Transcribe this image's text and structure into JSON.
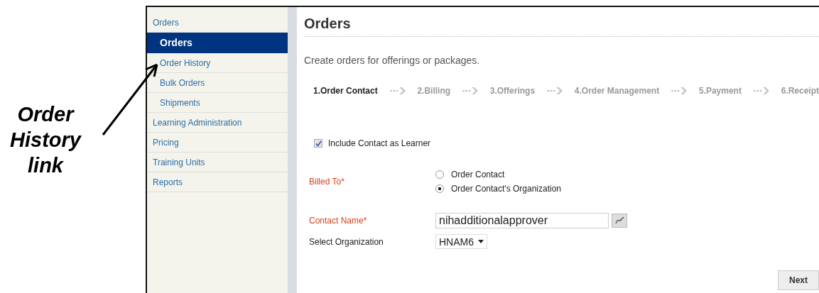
{
  "annotation": {
    "text": "Order History link"
  },
  "sidebar": {
    "items": [
      {
        "label": "Orders",
        "selected": false,
        "children": [
          {
            "label": "Orders",
            "selected": true
          },
          {
            "label": "Order History",
            "selected": false
          },
          {
            "label": "Bulk Orders",
            "selected": false
          },
          {
            "label": "Shipments",
            "selected": false
          }
        ]
      },
      {
        "label": "Learning Administration",
        "selected": false
      },
      {
        "label": "Pricing",
        "selected": false
      },
      {
        "label": "Training Units",
        "selected": false
      },
      {
        "label": "Reports",
        "selected": false
      }
    ]
  },
  "page": {
    "title": "Orders",
    "description": "Create orders for offerings or packages."
  },
  "steps": [
    {
      "label": "1.Order Contact",
      "selected": true
    },
    {
      "label": "2.Billing",
      "selected": false
    },
    {
      "label": "3.Offerings",
      "selected": false
    },
    {
      "label": "4.Order Management",
      "selected": false
    },
    {
      "label": "5.Payment",
      "selected": false
    },
    {
      "label": "6.Receipt",
      "selected": false
    }
  ],
  "include_contact": {
    "label": "Include Contact as Learner",
    "checked": true
  },
  "billed_to": {
    "label": "Billed To*",
    "required": true,
    "options": [
      {
        "label": "Order Contact",
        "selected": false
      },
      {
        "label": "Order Contact's Organization",
        "selected": true
      }
    ]
  },
  "contact_name": {
    "label": "Contact Name*",
    "required": true,
    "value": "nihadditionalapprover"
  },
  "organization": {
    "label": "Select Organization",
    "required": false,
    "value": "HNAM6"
  },
  "buttons": [
    "Next"
  ]
}
